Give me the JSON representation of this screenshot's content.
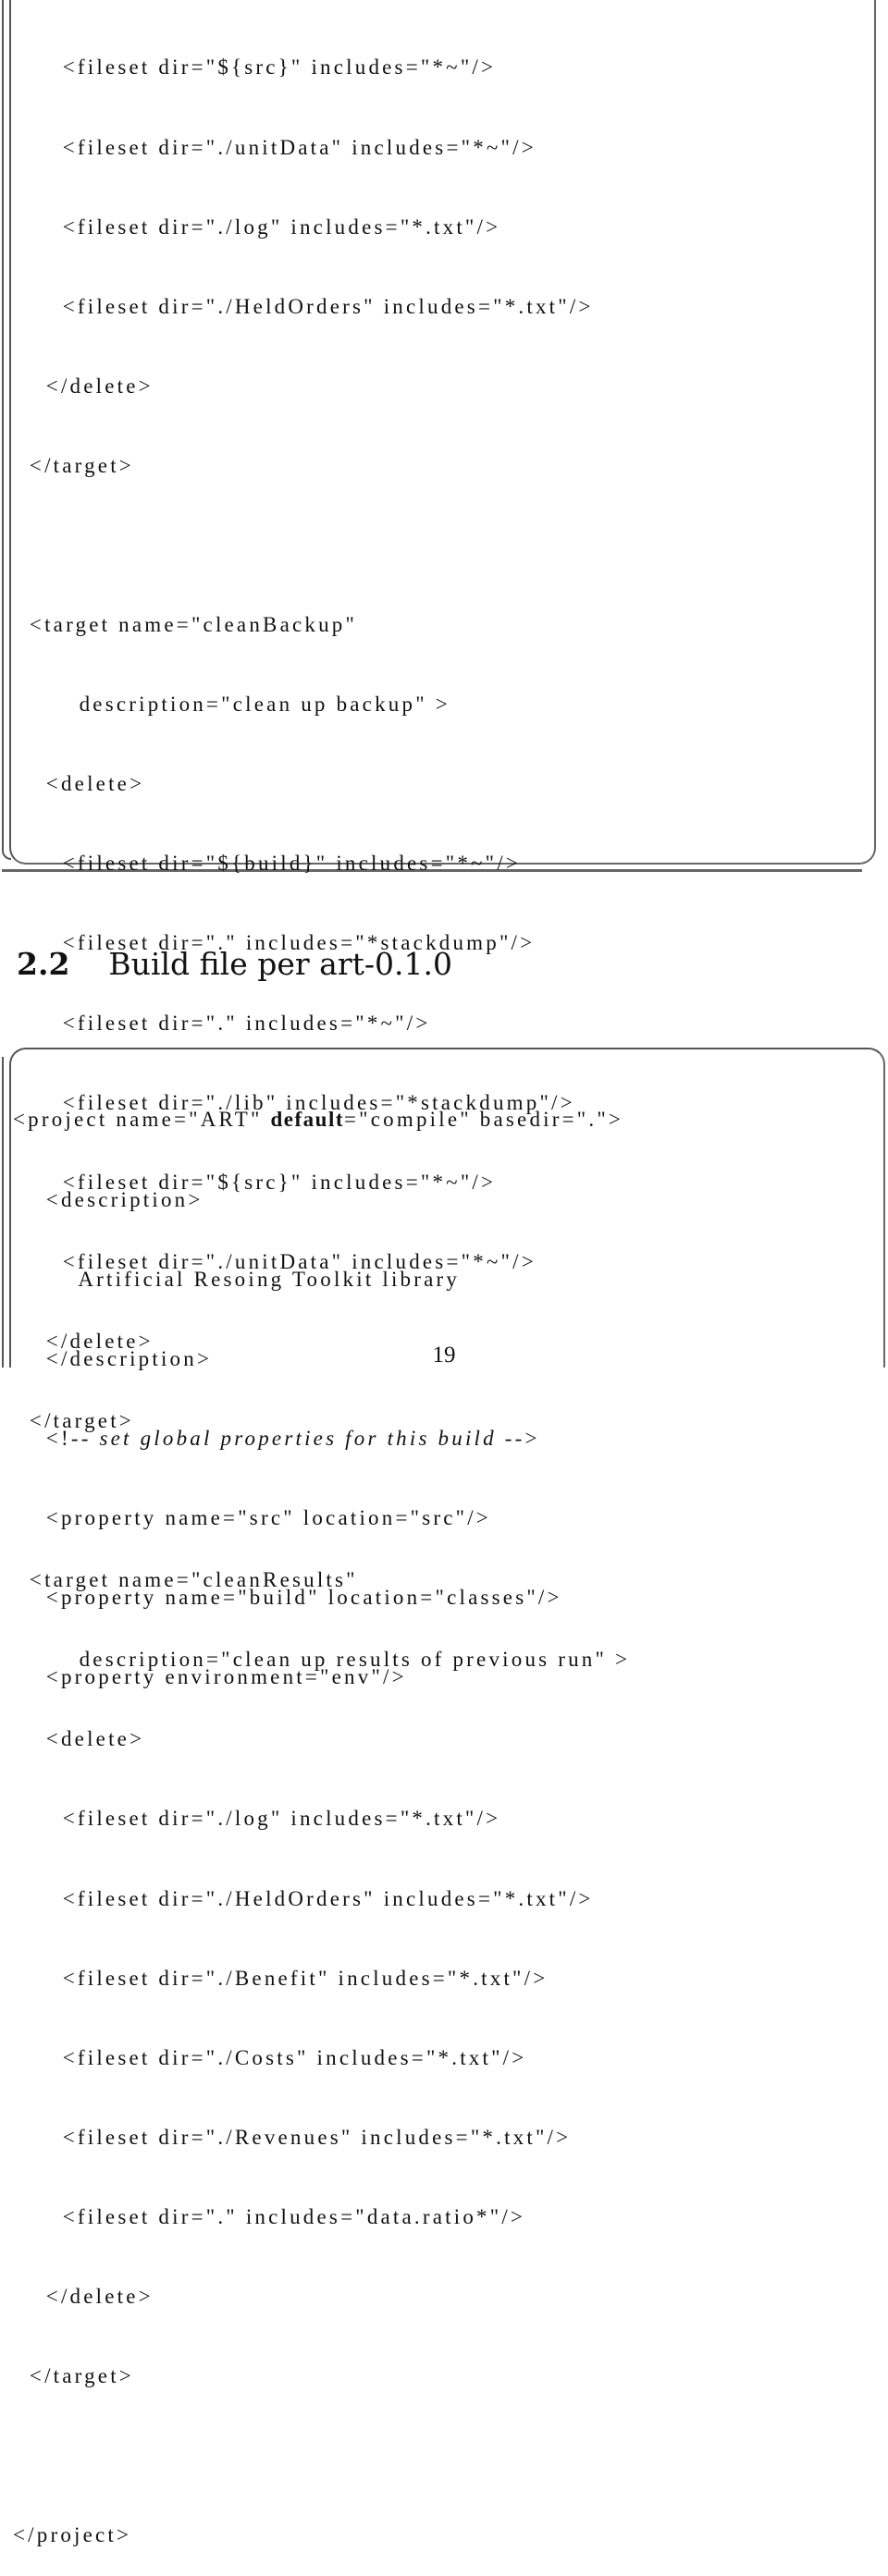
{
  "listing1": {
    "lines": [
      "      <fileset dir=\"${src}\" includes=\"*~\"/>",
      "      <fileset dir=\"./unitData\" includes=\"*~\"/>",
      "      <fileset dir=\"./log\" includes=\"*.txt\"/>",
      "      <fileset dir=\"./HeldOrders\" includes=\"*.txt\"/>",
      "    </delete>",
      "  </target>",
      "",
      "  <target name=\"cleanBackup\"",
      "        description=\"clean up backup\" >",
      "    <delete>",
      "      <fileset dir=\"${build}\" includes=\"*~\"/>",
      "      <fileset dir=\".\" includes=\"*stackdump\"/>",
      "      <fileset dir=\".\" includes=\"*~\"/>",
      "      <fileset dir=\"./lib\" includes=\"*stackdump\"/>",
      "      <fileset dir=\"${src}\" includes=\"*~\"/>",
      "      <fileset dir=\"./unitData\" includes=\"*~\"/>",
      "    </delete>",
      "  </target>",
      "",
      "  <target name=\"cleanResults\"",
      "        description=\"clean up results of previous run\" >",
      "    <delete>",
      "      <fileset dir=\"./log\" includes=\"*.txt\"/>",
      "      <fileset dir=\"./HeldOrders\" includes=\"*.txt\"/>",
      "      <fileset dir=\"./Benefit\" includes=\"*.txt\"/>",
      "      <fileset dir=\"./Costs\" includes=\"*.txt\"/>",
      "      <fileset dir=\"./Revenues\" includes=\"*.txt\"/>",
      "      <fileset dir=\".\" includes=\"data.ratio*\"/>",
      "    </delete>",
      "  </target>",
      "",
      "</project>"
    ]
  },
  "section": {
    "number": "2.2",
    "title": "Build file per art-0.1.0"
  },
  "listing2": {
    "line0_pre": "<project name=\"ART\" ",
    "line0_kw": "default",
    "line0_post": "=\"compile\" basedir=\".\">",
    "line1": "    <description>",
    "line2": "        Artificial Resoing Toolkit library",
    "line3": "    </description>",
    "line4_pre": "    <!-- ",
    "line4_comment": "set global properties for this build",
    "line4_post": " -->",
    "line5": "    <property name=\"src\" location=\"src\"/>",
    "line6": "    <property name=\"build\" location=\"classes\"/>",
    "line7": "    <property environment=\"env\"/>"
  },
  "page_number": "19"
}
